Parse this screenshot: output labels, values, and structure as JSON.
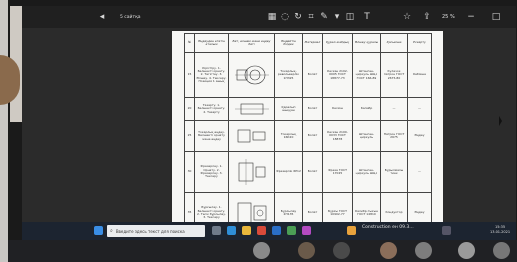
{
  "viewer": {
    "filename": "5 сайтқа",
    "zoom": "25 %",
    "toolbar_icons": [
      "grid-icon",
      "lasso-icon",
      "rotate-icon",
      "crop-icon",
      "pen-icon",
      "highlighter-icon",
      "eraser-icon",
      "text-icon",
      "star-icon",
      "share-icon",
      "zoom-icon"
    ]
  },
  "document": {
    "headers": [
      "№",
      "Өңдеуден өтетін аталым",
      "Бет, өлшем және өңдеу беті",
      "Өңдейтін білдек",
      "Материал",
      "Құрал-жабдық",
      "Өлшеу құралы",
      "Қосымша",
      "Ескерту"
    ],
    "rows": [
      {
        "num": "15",
        "ops": "Кірістіру. 1. Бөлшекті орнату. 2. Тегістеу. 3. Өлшеу. 4. Тексеру. Позиция 1 ашық",
        "machine": "Токарлық-револьверлік 1Н325",
        "material": "Болат",
        "tool": "Кескіш 2102-0005 ГОСТ 18877-73",
        "measure": "Штанген-циркуль ШЦ-I ГОСТ 166-89",
        "extra": "Кулачок патрон ГОСТ 2675-80",
        "note": "Көбікше"
      },
      {
        "num": "20",
        "ops": "Тазарту. 1. Бөлшекті орнату. 2. Тазарту",
        "machine": "Қаралып шыққан",
        "material": "Болат",
        "tool": "Кескіш",
        "measure": "Калибр",
        "extra": "—",
        "note": "—"
      },
      {
        "num": "25",
        "ops": "Токарлық өңдеу. Бөлшекті орнату және өңдеу",
        "machine": "Токарлық 16К20",
        "material": "Болат",
        "tool": "Кескіш 2100-0033 ГОСТ 18878",
        "measure": "Штанген-циркуль",
        "extra": "Патрон ГОСТ 2675",
        "note": "Өңдеу"
      },
      {
        "num": "30",
        "ops": "Фрезерлеу. 1. Орнату. 2. Фрезерлеу. 3. Тексеру",
        "machine": "Фрезерлік 6Р12",
        "material": "Болат",
        "tool": "Фреза ГОСТ 17025",
        "measure": "Штанген-циркуль ШЦ-I",
        "extra": "Бұрылмалы тиек",
        "note": "—"
      },
      {
        "num": "35",
        "ops": "Бұрғылау. 1. Бөлшекті орнату. 2. Тесік бұрғылау. 3. Тексеру",
        "machine": "Бұрғылау 2Н135",
        "material": "Болат",
        "tool": "Бұрғы ГОСТ 10902-77",
        "measure": "Калибр-тығын ГОСТ 14810",
        "extra": "Кондуктор",
        "note": "Өңдеу"
      }
    ]
  },
  "taskbar": {
    "search_placeholder": "Введите здесь текст для поиска",
    "app_title": "Construction ен 09.3…",
    "time": "15:35",
    "date": "13.01.2021"
  }
}
